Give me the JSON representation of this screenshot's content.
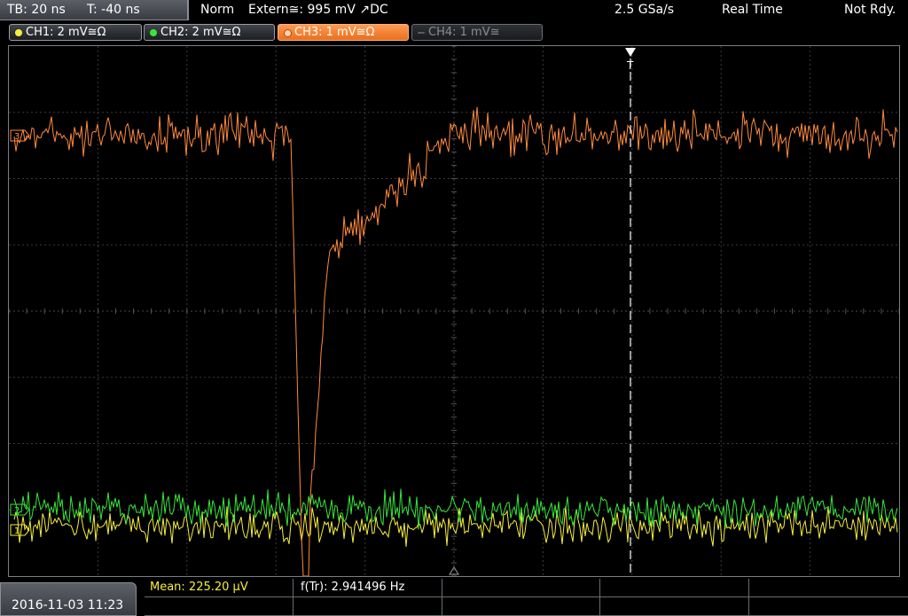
{
  "header": {
    "timebase": "TB: 20 ns",
    "trigger_time": "T: -40 ns",
    "mode": "Norm",
    "trigger": "Extern≅: 995 mV ↗DC",
    "sample_rate": "2.5 GSa/s",
    "acq_mode": "Real Time",
    "status": "Not Rdy."
  },
  "channels": [
    {
      "label": "CH1: 2 mV≅Ω",
      "color": "#f5ef3a",
      "state": "on"
    },
    {
      "label": "CH2: 2 mV≅Ω",
      "color": "#37e63a",
      "state": "on"
    },
    {
      "label": "CH3: 1 mV≅Ω",
      "color": "#ff8a3d",
      "state": "selected"
    },
    {
      "label": "CH4: 1 mV≅",
      "color": "#8a8c92",
      "state": "off"
    }
  ],
  "markers": {
    "ch1": "1",
    "ch2": "2",
    "ch3": "3",
    "trigger_pos": "T"
  },
  "footer": {
    "datetime": "2016-11-03 11:23",
    "measurement_1": "Mean: 225.20 µV",
    "measurement_2": "f(Tr): 2.941496 Hz"
  },
  "colors": {
    "ch1": "#f5ef3a",
    "ch2": "#37e63a",
    "ch3": "#ff8a3d",
    "grid": "#3b3b3b"
  }
}
